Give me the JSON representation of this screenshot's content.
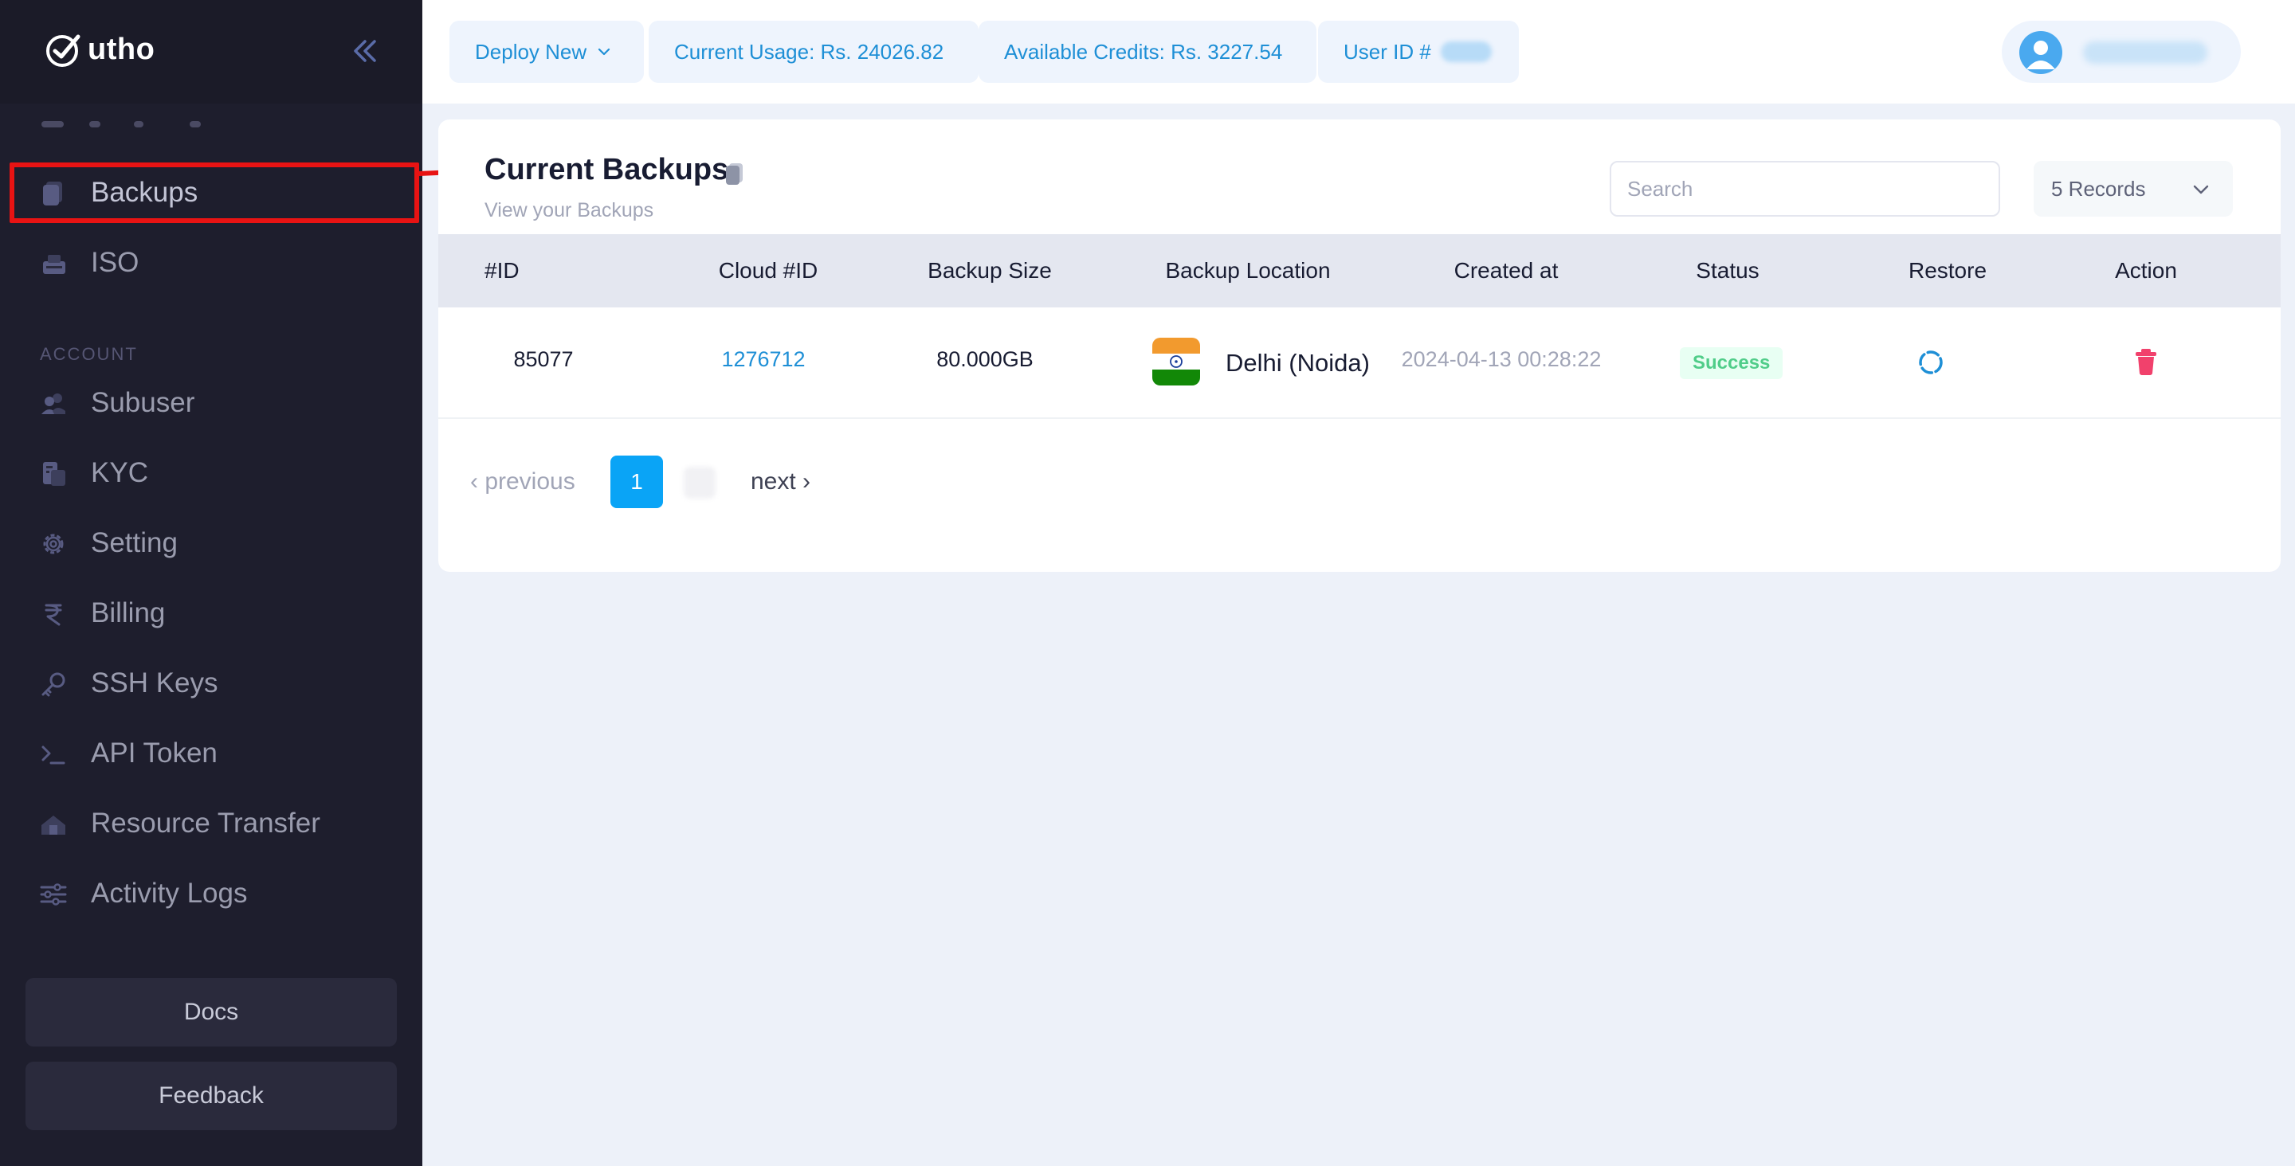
{
  "brand": {
    "logo_text": "utho"
  },
  "sidebar": {
    "items": [
      {
        "id": "backups",
        "label": "Backups",
        "icon": "backup-icon"
      },
      {
        "id": "iso",
        "label": "ISO",
        "icon": "disc-icon"
      }
    ],
    "section_label": "ACCOUNT",
    "account_items": [
      {
        "id": "subuser",
        "label": "Subuser",
        "icon": "users-icon"
      },
      {
        "id": "kyc",
        "label": "KYC",
        "icon": "id-card-icon"
      },
      {
        "id": "setting",
        "label": "Setting",
        "icon": "gear-icon"
      },
      {
        "id": "billing",
        "label": "Billing",
        "icon": "rupee-icon"
      },
      {
        "id": "ssh-keys",
        "label": "SSH Keys",
        "icon": "key-icon"
      },
      {
        "id": "api-token",
        "label": "API Token",
        "icon": "terminal-icon"
      },
      {
        "id": "resource-transfer",
        "label": "Resource Transfer",
        "icon": "transfer-icon"
      },
      {
        "id": "activity-logs",
        "label": "Activity Logs",
        "icon": "sliders-icon"
      }
    ],
    "docs_label": "Docs",
    "feedback_label": "Feedback"
  },
  "topbar": {
    "deploy_label": "Deploy New",
    "usage_label": "Current Usage: Rs. 24026.82",
    "credits_label": "Available Credits: Rs. 3227.54",
    "user_id_label": "User ID #"
  },
  "main": {
    "title": "Current Backups",
    "subtitle": "View your Backups",
    "search": {
      "placeholder": "Search",
      "value": ""
    },
    "records_select": "5 Records",
    "table": {
      "headers": [
        "#ID",
        "Cloud #ID",
        "Backup Size",
        "Backup Location",
        "Created at",
        "Status",
        "Restore",
        "Action"
      ],
      "rows": [
        {
          "id": "85077",
          "cloud_id": "1276712",
          "size": "80.000GB",
          "location": "Delhi (Noida)",
          "created_at": "2024-04-13 00:28:22",
          "status": "Success"
        }
      ]
    },
    "pagination": {
      "previous": "‹ previous",
      "current_page": "1",
      "next": "next ›"
    }
  },
  "colors": {
    "sidebar_bg": "#1e1e2d",
    "accent": "#1e8fd6",
    "page_active": "#0aa4f6",
    "success": "#50cd89",
    "danger": "#f1416c",
    "annotation": "#e81313"
  }
}
